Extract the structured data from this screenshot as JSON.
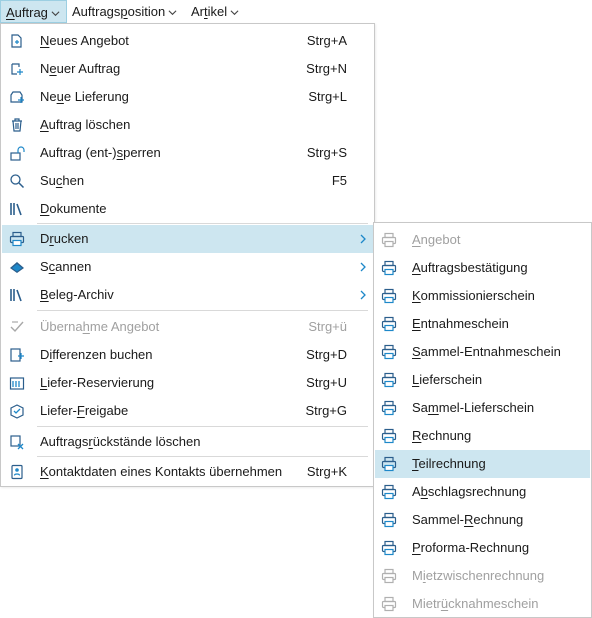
{
  "menubar": {
    "items": [
      {
        "label_u": "A",
        "label_rest": "uftrag"
      },
      {
        "label_pre": "Auftrags",
        "label_u": "p",
        "label_rest": "osition"
      },
      {
        "label_pre": "Ar",
        "label_u": "t",
        "label_rest": "ikel"
      }
    ]
  },
  "main_menu": {
    "items": [
      {
        "pre": "",
        "u": "N",
        "rest": "eues Angebot",
        "shortcut": "Strg+A"
      },
      {
        "pre": "N",
        "u": "e",
        "rest": "uer Auftrag",
        "shortcut": "Strg+N"
      },
      {
        "pre": "Ne",
        "u": "u",
        "rest": "e Lieferung",
        "shortcut": "Strg+L"
      },
      {
        "pre": "",
        "u": "A",
        "rest": "uftrag löschen",
        "shortcut": ""
      },
      {
        "pre": "Auftrag (ent-)",
        "u": "s",
        "rest": "perren",
        "shortcut": "Strg+S"
      },
      {
        "pre": "Su",
        "u": "c",
        "rest": "hen",
        "shortcut": "F5"
      },
      {
        "pre": "",
        "u": "D",
        "rest": "okumente",
        "shortcut": ""
      },
      {
        "pre": "D",
        "u": "r",
        "rest": "ucken",
        "shortcut": ""
      },
      {
        "pre": "S",
        "u": "c",
        "rest": "annen",
        "shortcut": ""
      },
      {
        "pre": "",
        "u": "B",
        "rest": "eleg-Archiv",
        "shortcut": ""
      },
      {
        "pre": "Überna",
        "u": "h",
        "rest": "me Angebot",
        "shortcut": "Strg+ü"
      },
      {
        "pre": "D",
        "u": "i",
        "rest": "fferenzen buchen",
        "shortcut": "Strg+D"
      },
      {
        "pre": "",
        "u": "L",
        "rest": "iefer-Reservierung",
        "shortcut": "Strg+U"
      },
      {
        "pre": "Liefer-",
        "u": "F",
        "rest": "reigabe",
        "shortcut": "Strg+G"
      },
      {
        "pre": "Auftrags",
        "u": "r",
        "rest": "ückstände löschen",
        "shortcut": ""
      },
      {
        "pre": "",
        "u": "K",
        "rest": "ontaktdaten eines Kontakts übernehmen",
        "shortcut": "Strg+K"
      }
    ]
  },
  "sub_menu": {
    "items": [
      {
        "pre": "",
        "u": "A",
        "rest": "ngebot"
      },
      {
        "pre": "",
        "u": "A",
        "rest": "uftragsbestätigung"
      },
      {
        "pre": "",
        "u": "K",
        "rest": "ommissionierschein"
      },
      {
        "pre": "",
        "u": "E",
        "rest": "ntnahmeschein"
      },
      {
        "pre": "",
        "u": "S",
        "rest": "ammel-Entnahmeschein"
      },
      {
        "pre": "",
        "u": "L",
        "rest": "ieferschein"
      },
      {
        "pre": "Sa",
        "u": "m",
        "rest": "mel-Lieferschein"
      },
      {
        "pre": "",
        "u": "R",
        "rest": "echnung"
      },
      {
        "pre": "",
        "u": "T",
        "rest": "eilrechnung"
      },
      {
        "pre": "A",
        "u": "b",
        "rest": "schlagsrechnung"
      },
      {
        "pre": "Sammel-",
        "u": "R",
        "rest": "echnung"
      },
      {
        "pre": "",
        "u": "P",
        "rest": "roforma-Rechnung"
      },
      {
        "pre": "M",
        "u": "i",
        "rest": "etzwischenrechnung"
      },
      {
        "pre": "Mietr",
        "u": "ü",
        "rest": "cknahmeschein"
      }
    ]
  },
  "colors": {
    "accent": "#1e88c9",
    "highlight": "#cde6f0",
    "disabled": "#a0a0a0"
  }
}
